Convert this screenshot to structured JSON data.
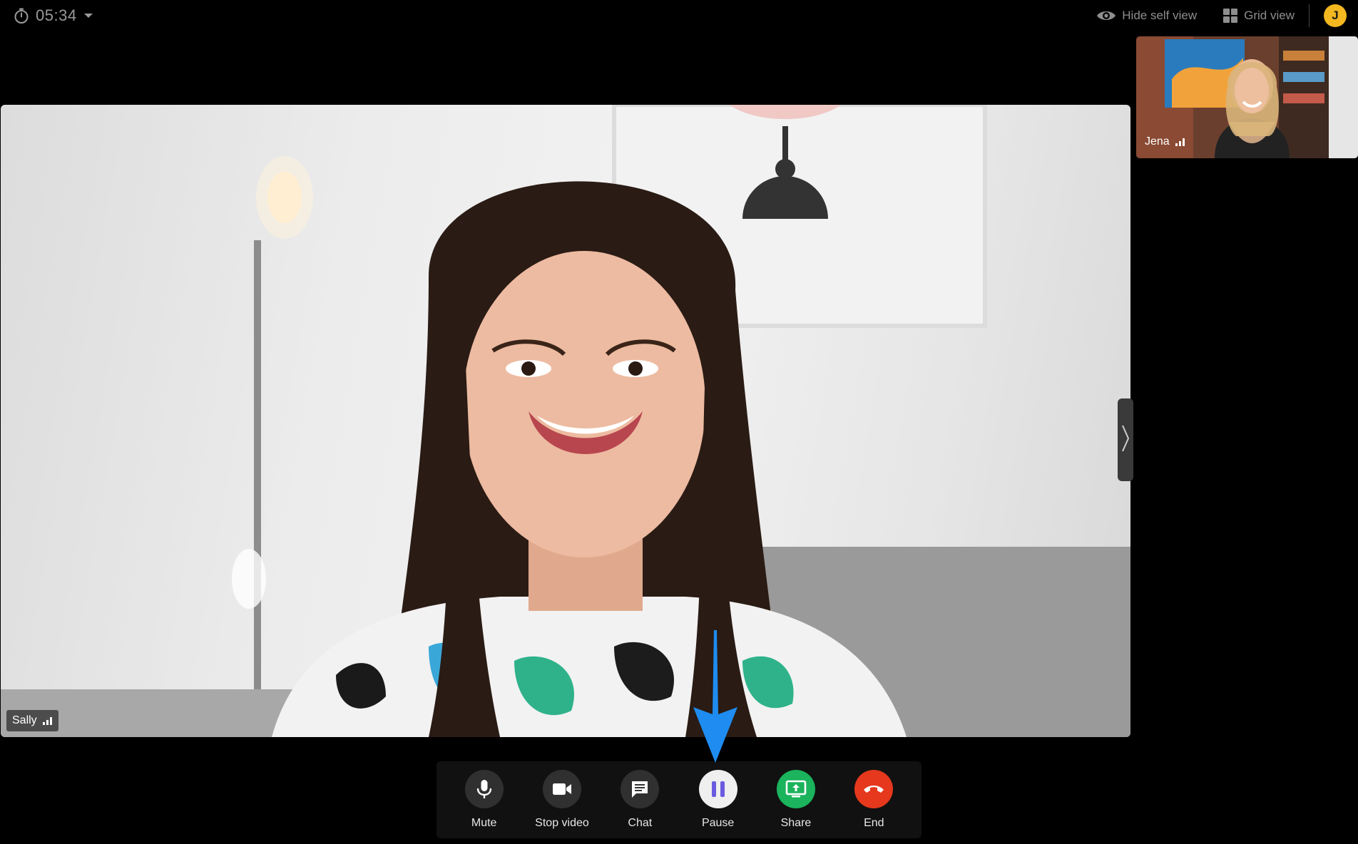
{
  "timer": {
    "time": "05:34",
    "icon": "stopwatch-icon"
  },
  "top_bar": {
    "hide_self_view_label": "Hide self view",
    "grid_view_label": "Grid view",
    "avatar_initial": "J"
  },
  "main_video": {
    "participant_name": "Sally"
  },
  "self_view": {
    "participant_name": "Jena"
  },
  "controls": [
    {
      "label": "Mute",
      "icon": "microphone-icon"
    },
    {
      "label": "Stop video",
      "icon": "camera-icon"
    },
    {
      "label": "Chat",
      "icon": "chat-icon"
    },
    {
      "label": "Pause",
      "icon": "pause-icon"
    },
    {
      "label": "Share",
      "icon": "share-screen-icon"
    },
    {
      "label": "End",
      "icon": "hang-up-icon"
    }
  ],
  "colors": {
    "accent_pause": "#6a5be0",
    "share": "#1bb35c",
    "end": "#e5381c",
    "avatar": "#f3b820",
    "annotation_arrow": "#1e8cf0"
  }
}
